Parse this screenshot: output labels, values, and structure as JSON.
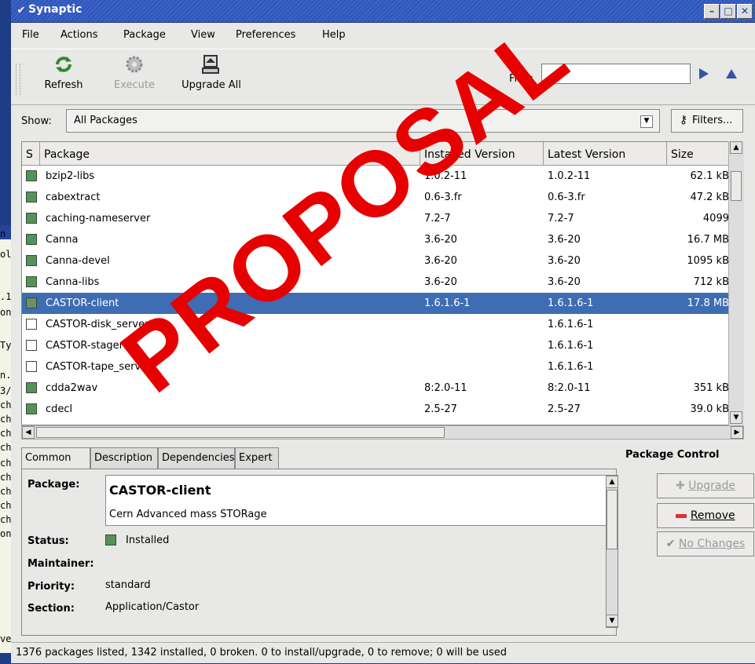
{
  "window": {
    "title": "Synaptic"
  },
  "menubar": [
    "File",
    "Actions",
    "Package",
    "View",
    "Preferences",
    "Help"
  ],
  "toolbar": {
    "refresh": "Refresh",
    "execute": "Execute",
    "upgrade_all": "Upgrade All",
    "find_label": "Find:",
    "find_value": ""
  },
  "filter": {
    "show_label": "Show:",
    "selected": "All Packages",
    "filters_button": "Filters..."
  },
  "columns": [
    "S",
    "Package",
    "Installed Version",
    "Latest Version",
    "Size"
  ],
  "packages": [
    {
      "name": "bzip2-libs",
      "installed": "1.0.2-11",
      "latest": "1.0.2-11",
      "size": "62.1 kB",
      "status": "installed"
    },
    {
      "name": "cabextract",
      "installed": "0.6-3.fr",
      "latest": "0.6-3.fr",
      "size": "47.2 kB",
      "status": "installed"
    },
    {
      "name": "caching-nameserver",
      "installed": "7.2-7",
      "latest": "7.2-7",
      "size": "4099",
      "status": "installed"
    },
    {
      "name": "Canna",
      "installed": "3.6-20",
      "latest": "3.6-20",
      "size": "16.7 MB",
      "status": "installed"
    },
    {
      "name": "Canna-devel",
      "installed": "3.6-20",
      "latest": "3.6-20",
      "size": "1095 kB",
      "status": "installed"
    },
    {
      "name": "Canna-libs",
      "installed": "3.6-20",
      "latest": "3.6-20",
      "size": "712 kB",
      "status": "installed"
    },
    {
      "name": "CASTOR-client",
      "installed": "1.6.1.6-1",
      "latest": "1.6.1.6-1",
      "size": "17.8 MB",
      "status": "installed"
    },
    {
      "name": "CASTOR-disk_server",
      "installed": "",
      "latest": "1.6.1.6-1",
      "size": "",
      "status": "not-installed"
    },
    {
      "name": "CASTOR-stager",
      "installed": "",
      "latest": "1.6.1.6-1",
      "size": "",
      "status": "not-installed"
    },
    {
      "name": "CASTOR-tape_server",
      "installed": "",
      "latest": "1.6.1.6-1",
      "size": "",
      "status": "not-installed"
    },
    {
      "name": "cdda2wav",
      "installed": "8:2.0-11",
      "latest": "8:2.0-11",
      "size": "351 kB",
      "status": "installed"
    },
    {
      "name": "cdecl",
      "installed": "2.5-27",
      "latest": "2.5-27",
      "size": "39.0 kB",
      "status": "installed"
    }
  ],
  "selected_index": 6,
  "tabs": [
    "Common",
    "Description",
    "Dependencies",
    "Expert"
  ],
  "details": {
    "package_label": "Package:",
    "package_name": "CASTOR-client",
    "package_summary": "Cern Advanced mass STORage",
    "status_label": "Status:",
    "status_value": "Installed",
    "maintainer_label": "Maintainer:",
    "maintainer_value": "",
    "priority_label": "Priority:",
    "priority_value": "standard",
    "section_label": "Section:",
    "section_value": "Application/Castor"
  },
  "package_control": {
    "title": "Package Control",
    "upgrade": "Upgrade",
    "remove": "Remove",
    "no_changes": "No Changes"
  },
  "statusbar": "1376 packages listed, 1342 installed, 0 broken. 0 to install/upgrade, 0 to remove; 0  will be used",
  "watermark": "PROPOSAL",
  "background_window_text": [
    "n",
    "ole",
    ".1",
    "on",
    "Ty",
    "n.",
    "3/",
    "ch",
    "ch",
    "ch",
    "ch",
    "ch",
    "ch",
    "ch",
    "ch",
    "ch",
    "on",
    "ve"
  ],
  "colors": {
    "selection": "#3e6db4",
    "installed_box": "#5a8f5a",
    "desktop": "#1f3c86",
    "watermark": "#e60000"
  }
}
